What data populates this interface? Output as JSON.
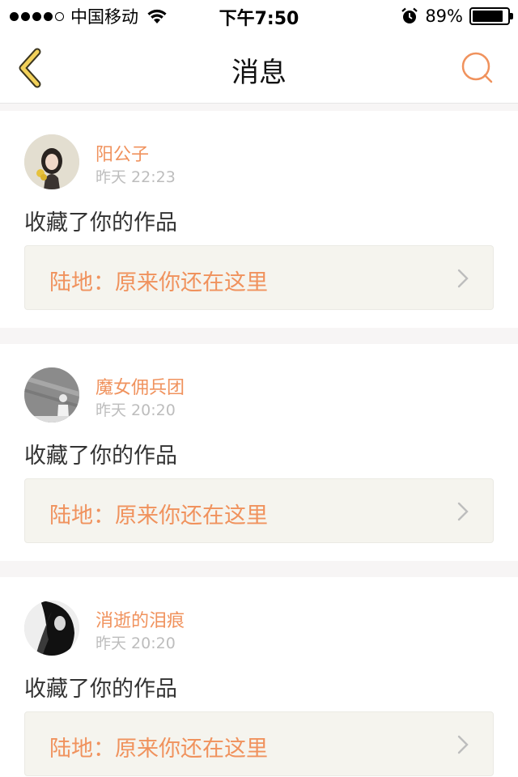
{
  "status_bar": {
    "carrier": "中国移动",
    "time": "下午7:50",
    "battery_percent": "89%",
    "battery_level": 0.89
  },
  "nav": {
    "title": "消息",
    "back_icon": "chevron-left-icon",
    "search_icon": "search-icon"
  },
  "colors": {
    "accent": "#f0925d",
    "back_icon": "#f2d15a",
    "card_bg": "#f5f4ee",
    "separator": "#f7f5f5"
  },
  "messages": [
    {
      "username": "阳公子",
      "time": "昨天 22:23",
      "action": "收藏了你的作品",
      "work_title": "陆地：原来你还在这里"
    },
    {
      "username": "魔女佣兵团",
      "time": "昨天 20:20",
      "action": "收藏了你的作品",
      "work_title": "陆地：原来你还在这里"
    },
    {
      "username": "消逝的泪痕",
      "time": "昨天 20:20",
      "action": "收藏了你的作品",
      "work_title": "陆地：原来你还在这里"
    }
  ]
}
